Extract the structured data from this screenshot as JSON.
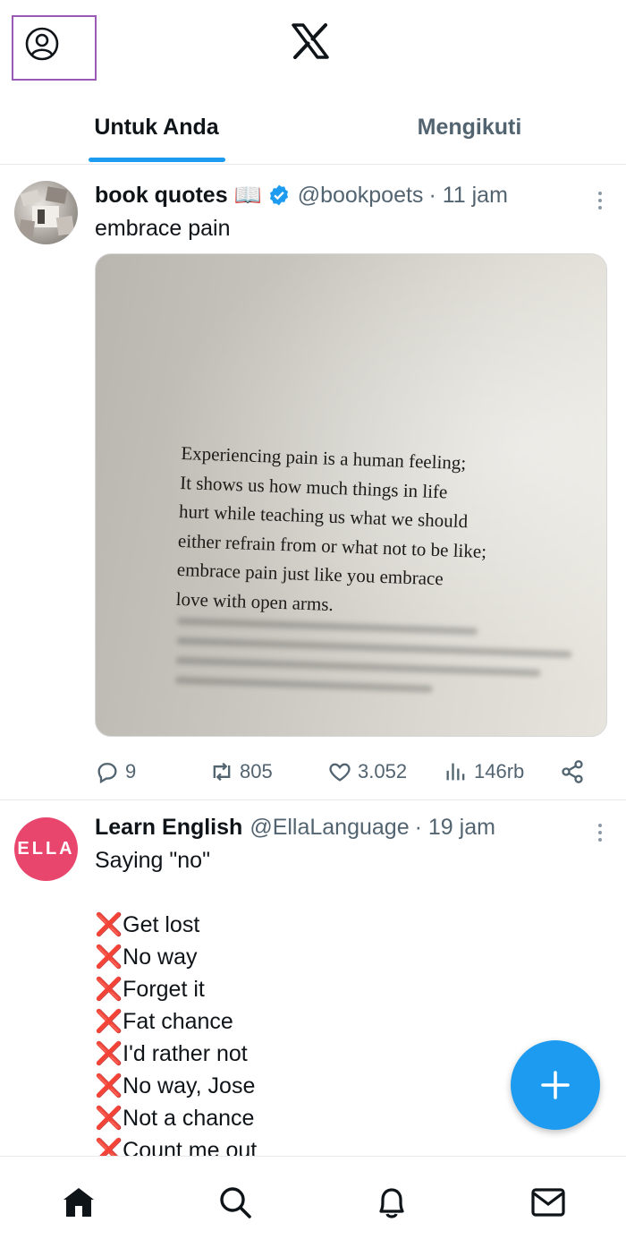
{
  "header": {
    "profile_icon": "person-circle-icon",
    "logo_icon": "x-logo-icon",
    "tabs": [
      {
        "label": "Untuk Anda",
        "active": true
      },
      {
        "label": "Mengikuti",
        "active": false
      }
    ]
  },
  "posts": [
    {
      "author": "book quotes 📖",
      "verified": true,
      "handle": "@bookpoets",
      "time": "· 11 jam",
      "text": "embrace pain",
      "media": {
        "quote_lines": [
          "Experiencing pain is a human feeling;",
          "It shows us how much things in life",
          "hurt while teaching us what we should",
          "either refrain from or what not to be like;",
          "embrace pain just like you embrace",
          "love with open arms."
        ]
      },
      "stats": {
        "replies": "9",
        "reposts": "805",
        "likes": "3.052",
        "views": "146rb"
      }
    },
    {
      "author": "Learn English",
      "handle": "@EllaLanguage",
      "time": "· 19 jam",
      "avatar_text": "ELLA",
      "text_intro": "Saying \"no\"",
      "list": [
        "Get lost",
        "No way",
        "Forget it",
        "Fat chance",
        "I'd rather not",
        "No way, Jose",
        "Not a chance",
        "Count me out"
      ],
      "list_marker": "❌"
    }
  ],
  "fab": {
    "icon": "plus-icon"
  },
  "bottom_nav": [
    "home-icon",
    "search-icon",
    "notifications-icon",
    "messages-icon"
  ],
  "colors": {
    "accent": "#1d9bf0",
    "text": "#0f1419",
    "muted": "#536471",
    "ella": "#e8466c"
  }
}
